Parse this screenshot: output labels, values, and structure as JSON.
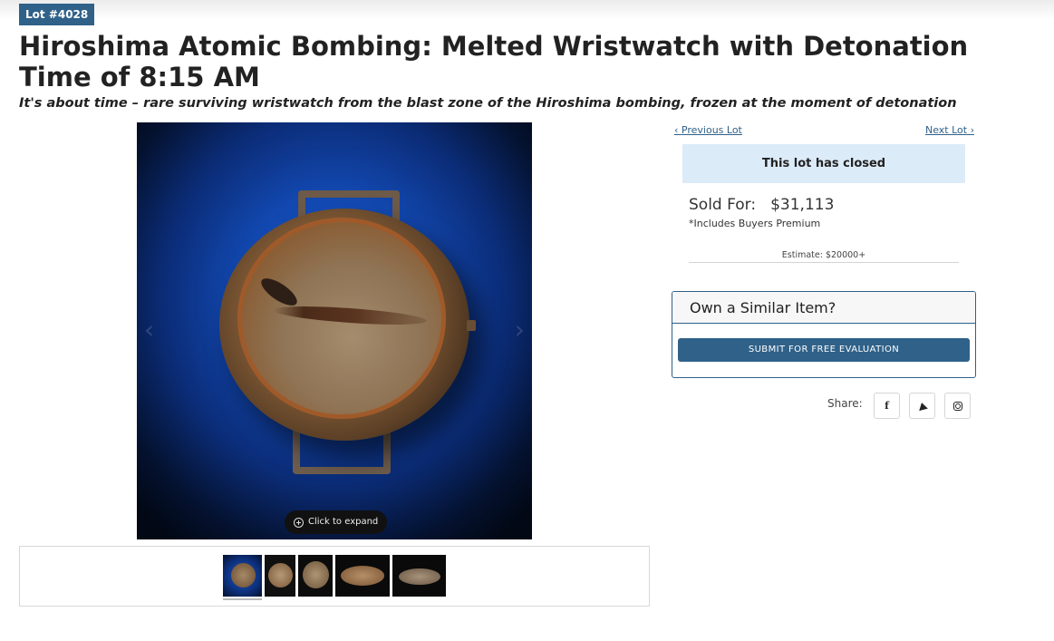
{
  "lot_badge": "Lot #4028",
  "title": "Hiroshima Atomic Bombing: Melted Wristwatch with Detonation Time of 8:15 AM",
  "subtitle": "It's about time – rare surviving wristwatch from the blast zone of the Hiroshima bombing, frozen at the moment of detonation",
  "gallery": {
    "expand_label": "Click to expand",
    "thumbnail_count": 5,
    "selected_thumbnail": 1
  },
  "lot_nav": {
    "previous_label": "Previous Lot",
    "next_label": "Next Lot"
  },
  "status": {
    "closed_text": "This lot has closed",
    "sold_label": "Sold For:",
    "sold_amount": "$31,113",
    "premium_note": "*Includes Buyers Premium",
    "estimate": "Estimate: $20000+"
  },
  "similar_item": {
    "heading": "Own a Similar Item?",
    "button_label": "SUBMIT FOR FREE EVALUATION"
  },
  "share": {
    "label": "Share:",
    "networks": [
      "facebook-icon",
      "twitter-icon",
      "instagram-icon"
    ]
  },
  "colors": {
    "brand_blue": "#2f6189",
    "closed_banner": "#dcebf8"
  }
}
